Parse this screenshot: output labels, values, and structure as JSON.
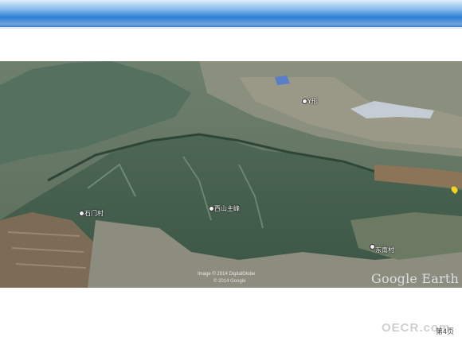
{
  "map": {
    "labels": {
      "top": "Y形",
      "left": "石门村",
      "center": "西山主峰",
      "right": "东南村"
    },
    "attribution_line1": "Image © 2014 DigitalGlobe",
    "attribution_line2": "© 2014 Google",
    "logo": "Google Earth"
  },
  "footer": {
    "watermark": "OECR.com",
    "page_number": "第4页"
  },
  "colors": {
    "banner_top": "#dfeefb",
    "banner_bottom": "#1f6cc4",
    "pin": "#f4d21d"
  }
}
